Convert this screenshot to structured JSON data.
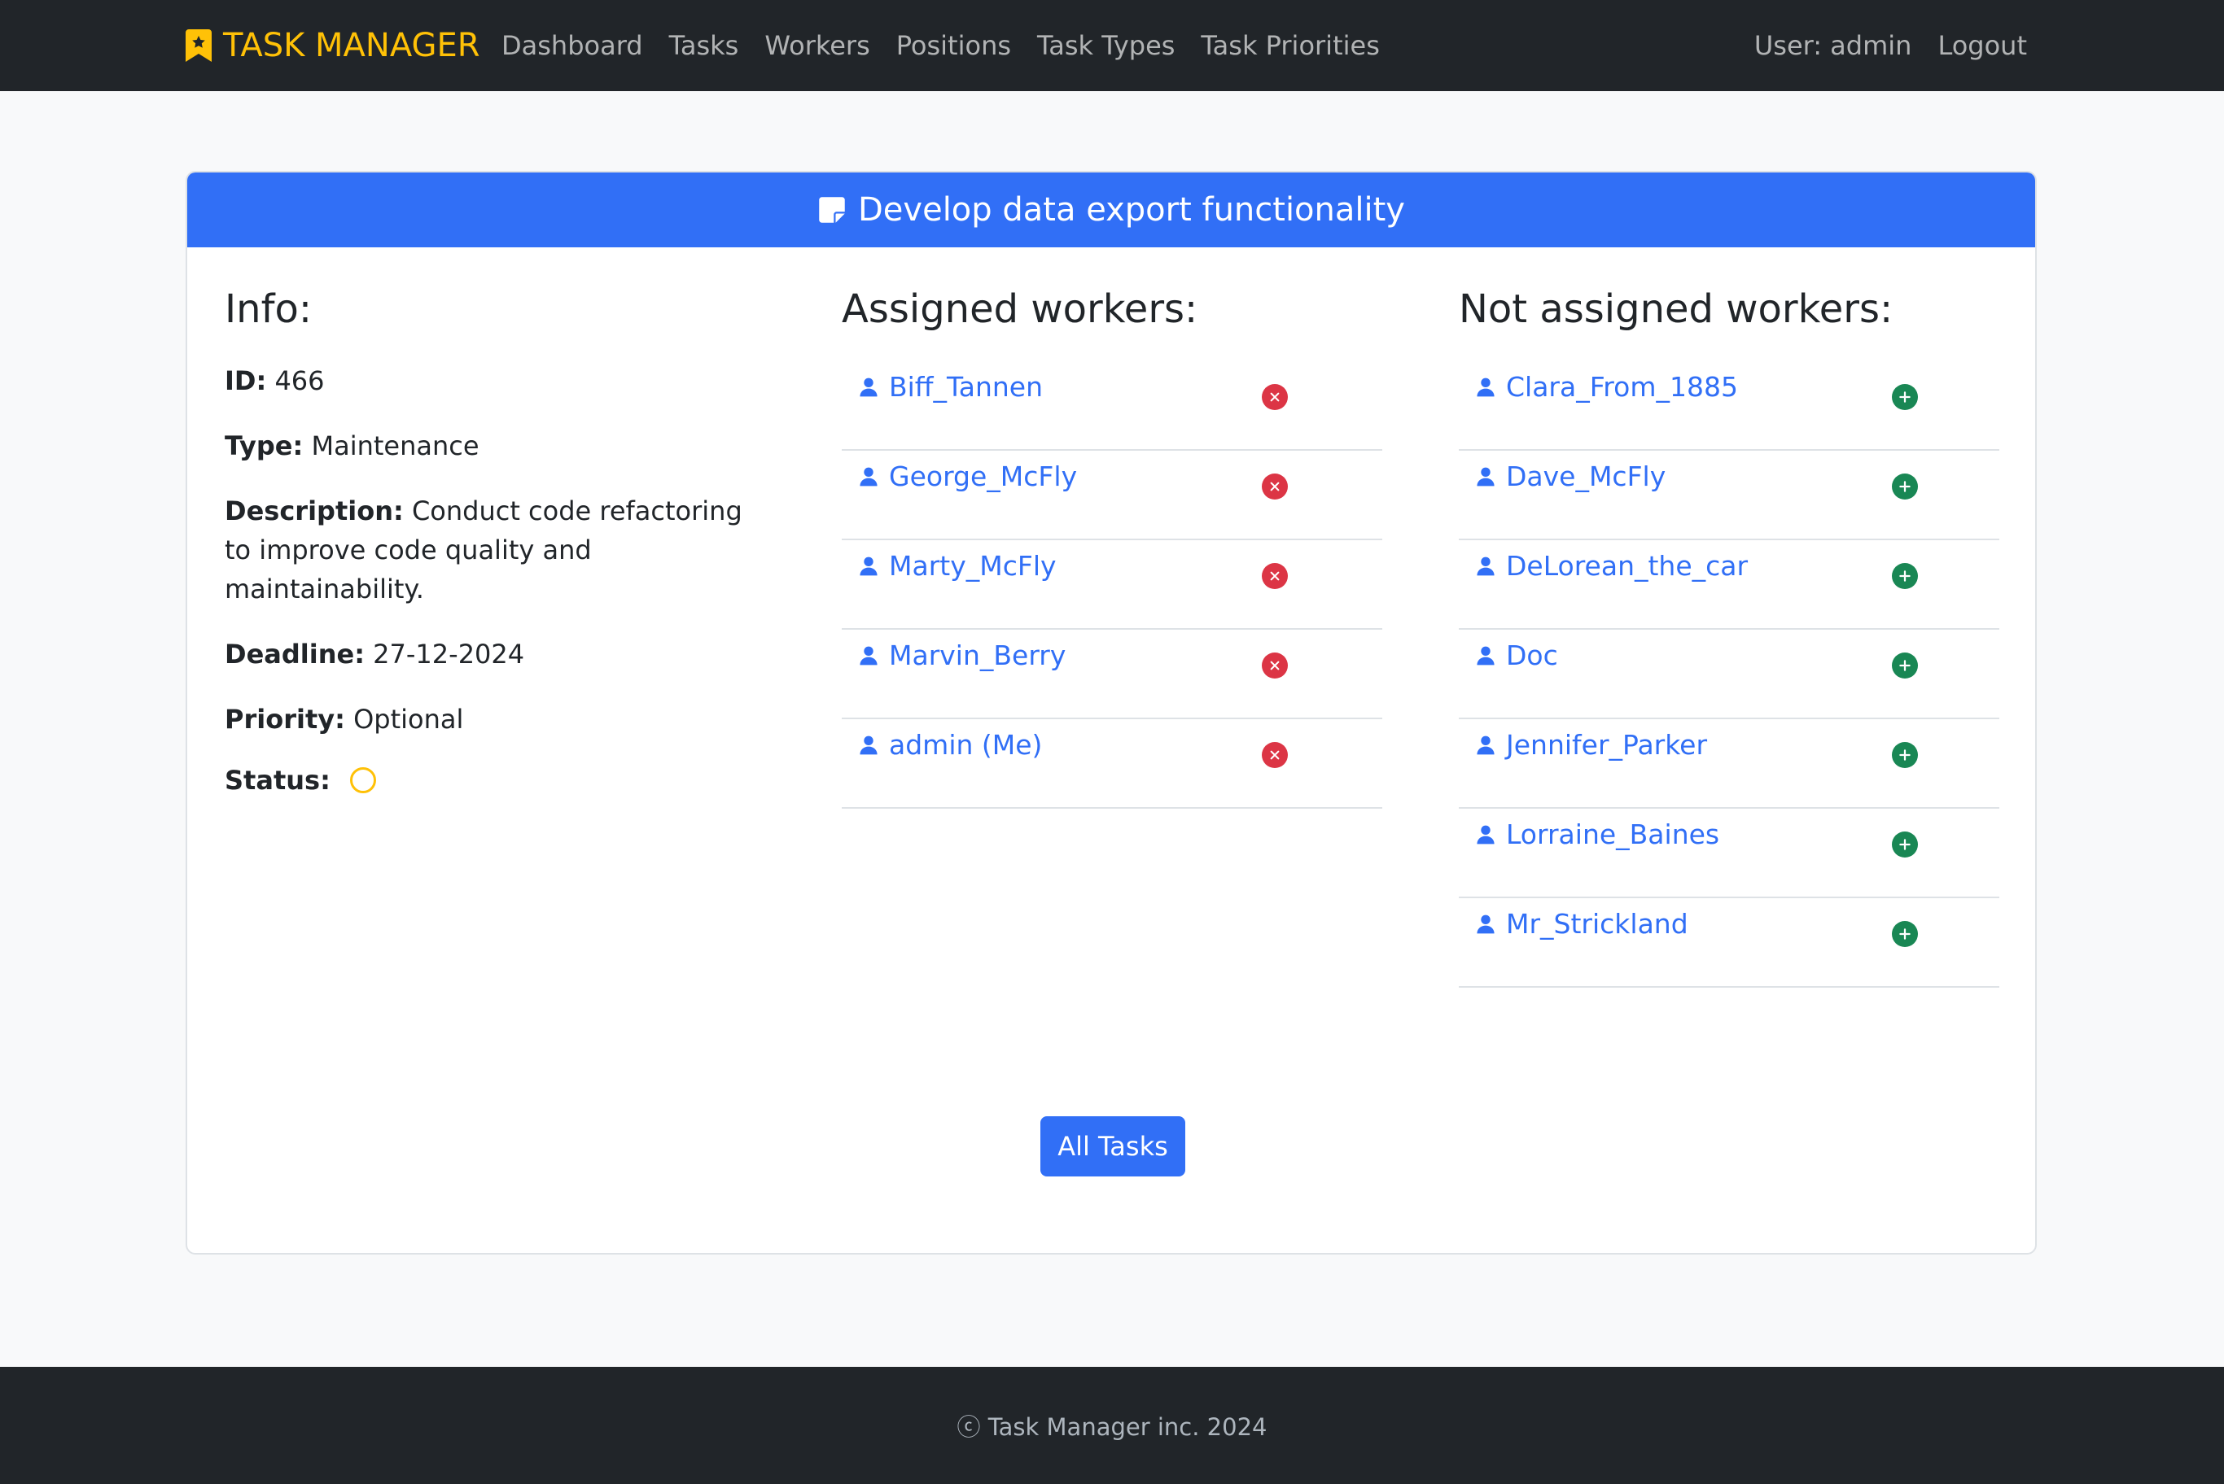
{
  "nav": {
    "brand": "TASK MANAGER",
    "links": [
      "Dashboard",
      "Tasks",
      "Workers",
      "Positions",
      "Task Types",
      "Task Priorities"
    ],
    "user": "User: admin",
    "logout": "Logout"
  },
  "task": {
    "title": "Develop data export functionality",
    "info_heading": "Info:",
    "id_label": "ID:",
    "id": "466",
    "type_label": "Type:",
    "type": "Maintenance",
    "description_label": "Description:",
    "description": "Conduct code refactoring to improve code quality and maintainability.",
    "deadline_label": "Deadline:",
    "deadline": "27-12-2024",
    "priority_label": "Priority:",
    "priority": "Optional",
    "status_label": "Status:",
    "status_color": "#ffc107"
  },
  "assigned": {
    "heading": "Assigned workers:",
    "workers": [
      "Biff_Tannen",
      "George_McFly",
      "Marty_McFly",
      "Marvin_Berry",
      "admin (Me)"
    ]
  },
  "unassigned": {
    "heading": "Not assigned workers:",
    "workers": [
      "Clara_From_1885",
      "Dave_McFly",
      "DeLorean_the_car",
      "Doc",
      "Jennifer_Parker",
      "Lorraine_Baines",
      "Mr_Strickland"
    ]
  },
  "all_tasks_button": "All Tasks",
  "footer": "ⓒ Task Manager inc. 2024",
  "colors": {
    "primary": "#316ff6",
    "navbar": "#212529",
    "brand": "#ffc107",
    "remove": "#dc3545",
    "add": "#198754"
  },
  "icons": {
    "brand": "bookmark-star-icon",
    "header": "sticky-note-icon",
    "worker": "person-icon",
    "remove": "x-circle-icon",
    "add": "plus-circle-icon"
  }
}
